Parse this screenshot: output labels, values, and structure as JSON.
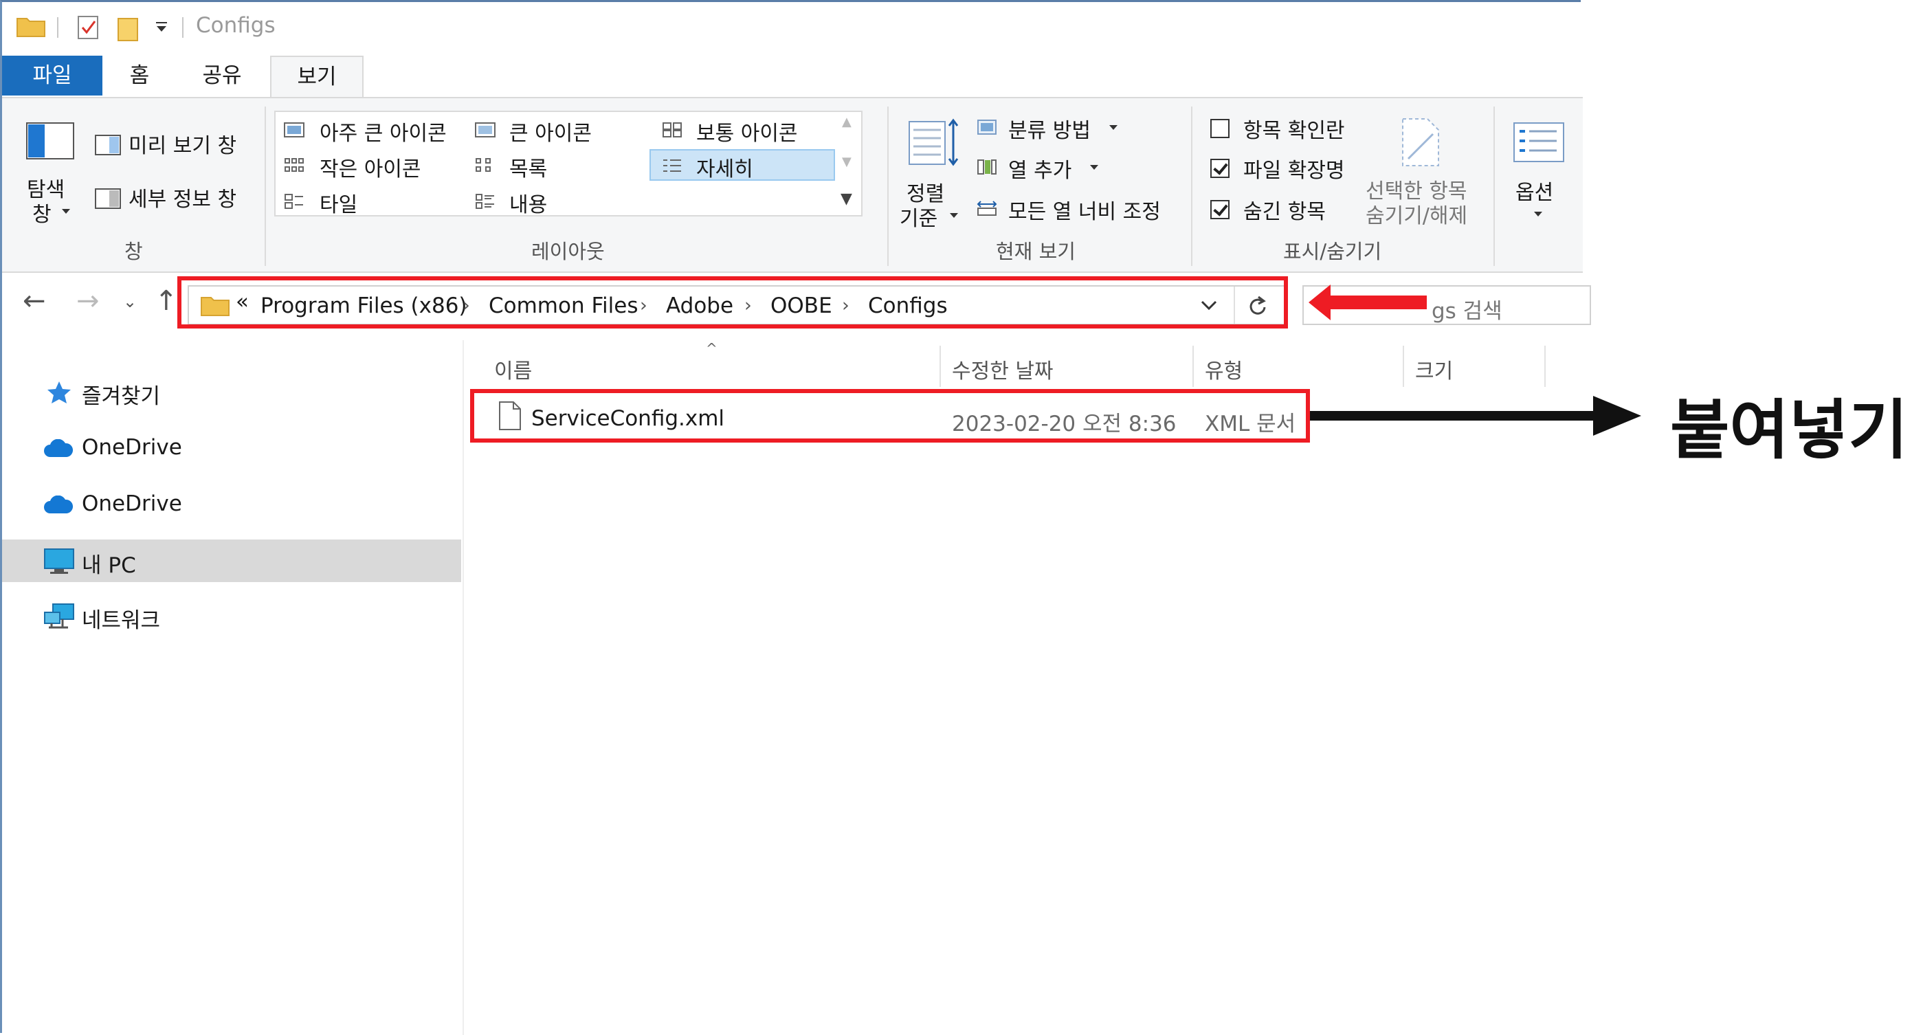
{
  "window": {
    "title": "Configs"
  },
  "tabs": [
    {
      "label": "파일"
    },
    {
      "label": "홈"
    },
    {
      "label": "공유"
    },
    {
      "label": "보기"
    }
  ],
  "ribbon": {
    "pane": {
      "nav_pane_line1": "탐색",
      "nav_pane_line2": "창",
      "preview_pane": "미리 보기 창",
      "details_pane": "세부 정보 창",
      "group_label": "창"
    },
    "layout": {
      "items": [
        "아주 큰 아이콘",
        "큰 아이콘",
        "보통 아이콘",
        "작은 아이콘",
        "목록",
        "자세히",
        "타일",
        "내용"
      ],
      "selected": "자세히",
      "group_label": "레이아웃"
    },
    "current_view": {
      "sort_line1": "정렬",
      "sort_line2": "기준",
      "group_by": "분류 방법",
      "add_column": "열 추가",
      "fit_columns": "모든 열 너비 조정",
      "group_label": "현재 보기"
    },
    "show_hide": {
      "item_checkboxes": {
        "label": "항목 확인란",
        "checked": false
      },
      "file_extensions": {
        "label": "파일 확장명",
        "checked": true
      },
      "hidden_items": {
        "label": "숨긴 항목",
        "checked": true
      },
      "hide_selected_line1": "선택한 항목",
      "hide_selected_line2": "숨기기/해제",
      "group_label": "표시/숨기기"
    },
    "options": {
      "label": "옵션"
    }
  },
  "address": {
    "overflow": "«",
    "crumbs": [
      "Program Files (x86)",
      "Common Files",
      "Adobe",
      "OOBE",
      "Configs"
    ],
    "separator": "›"
  },
  "search": {
    "placeholder": "gs 검색"
  },
  "nav_pane": [
    {
      "label": "즐겨찾기",
      "icon": "star-icon"
    },
    {
      "label": "OneDrive",
      "icon": "cloud-icon"
    },
    {
      "label": "OneDrive",
      "icon": "cloud-icon"
    },
    {
      "label": "내 PC",
      "icon": "computer-icon",
      "selected": true
    },
    {
      "label": "네트워크",
      "icon": "network-icon"
    }
  ],
  "columns": {
    "name": "이름",
    "date": "수정한 날짜",
    "type": "유형",
    "size": "크기"
  },
  "files": [
    {
      "name": "ServiceConfig.xml",
      "date": "2023-02-20 오전 8:36",
      "type": "XML 문서"
    }
  ],
  "annotation": {
    "text": "붙여넣기",
    "color": "#ee1c24"
  }
}
